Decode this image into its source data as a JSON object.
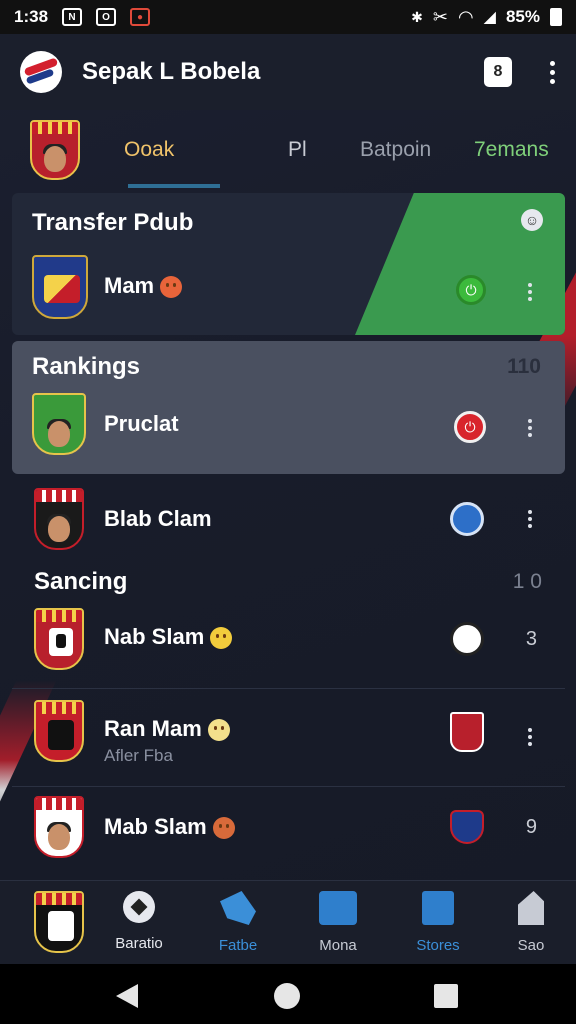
{
  "status_bar": {
    "time": "1:38",
    "battery": "85%"
  },
  "app": {
    "title": "Sepak L Bobela"
  },
  "tabs": [
    {
      "label": "Ooak",
      "color": "#f0c36a"
    },
    {
      "label": "Pl",
      "color": "#c9ccd4"
    },
    {
      "label": "Batpoin",
      "color": "#9aa0ac"
    },
    {
      "label": "7emans",
      "color": "#7fd07a"
    }
  ],
  "transfer_card": {
    "title": "Transfer Pdub",
    "item": {
      "name": "Mam"
    }
  },
  "rankings_card": {
    "title": "Rankings",
    "count": "110",
    "items": [
      {
        "name": "Pruclat"
      },
      {
        "name": "Blab Clam"
      }
    ]
  },
  "sancing_section": {
    "title": "Sancing",
    "count": "1 0",
    "items": [
      {
        "name": "Nab Slam",
        "value": "3"
      },
      {
        "name": "Ran Mam",
        "sub": "Afler Fba"
      },
      {
        "name": "Mab Slam",
        "value": "9"
      }
    ]
  },
  "bottom_nav": [
    {
      "label": "Baratio",
      "color": "#e6e8ee"
    },
    {
      "label": "Fatbe",
      "color": "#3b8fd8"
    },
    {
      "label": "Mona",
      "color": "#c7cbd4"
    },
    {
      "label": "Stores",
      "color": "#3b8fd8"
    },
    {
      "label": "Sao",
      "color": "#c7cbd4"
    }
  ],
  "colors": {
    "accent_green": "#3a9a4f",
    "accent_red": "#c41e2a",
    "accent_blue": "#3b8fd8",
    "background": "#1c2030"
  }
}
